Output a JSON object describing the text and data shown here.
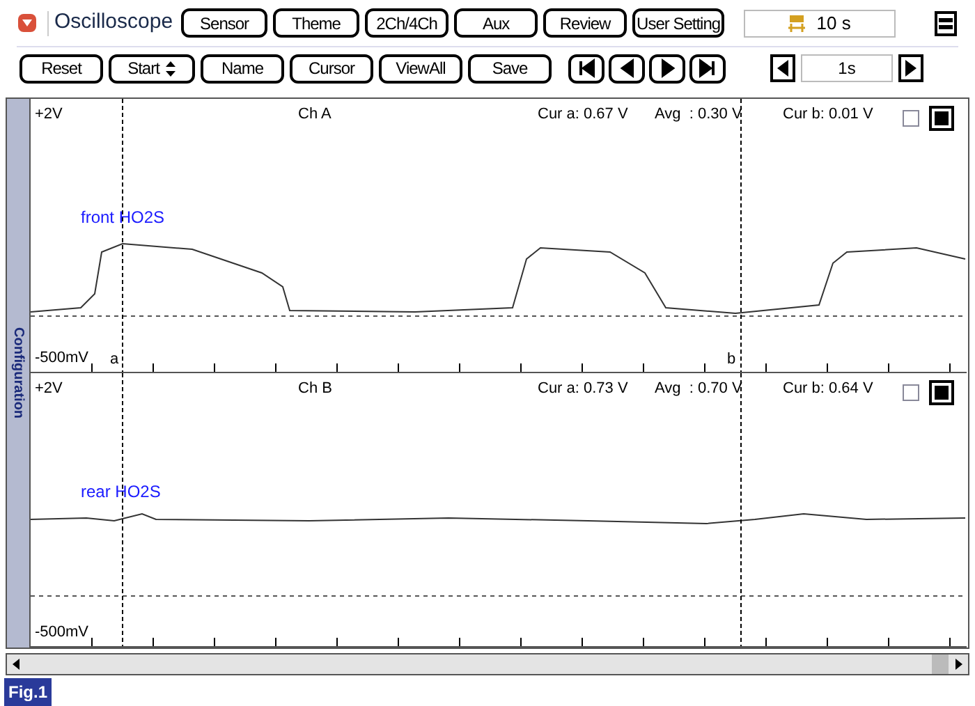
{
  "app_title": "Oscilloscope",
  "menu_buttons": [
    "Sensor",
    "Theme",
    "2Ch/4Ch",
    "Aux",
    "Review",
    "User Setting"
  ],
  "time_base": "10 s",
  "toolbar_buttons": [
    {
      "label": "Reset",
      "kind": "button"
    },
    {
      "label": "Start",
      "kind": "spinner"
    },
    {
      "label": "Name",
      "kind": "button"
    },
    {
      "label": "Cursor",
      "kind": "button"
    },
    {
      "label": "ViewAll",
      "kind": "button"
    },
    {
      "label": "Save",
      "kind": "button"
    }
  ],
  "step": "1s",
  "sidebar_label": "Configuration",
  "channels": [
    {
      "name": "Ch A",
      "top": "+2V",
      "bottom": "-500mV",
      "cur_a": "Cur a: 0.67 V",
      "avg": "Avg  : 0.30 V",
      "cur_b": "Cur b: 0.01 V",
      "trace_label": "front HO2S",
      "cursor_labels": [
        "a",
        "b"
      ],
      "kind": "square",
      "checked": false,
      "on": true
    },
    {
      "name": "Ch B",
      "top": "+2V",
      "bottom": "-500mV",
      "cur_a": "Cur a: 0.73 V",
      "avg": "Avg  : 0.70 V",
      "cur_b": "Cur b: 0.64 V",
      "trace_label": "rear HO2S",
      "kind": "flat",
      "checked": false,
      "on": true
    }
  ],
  "figure_label": "Fig.1"
}
